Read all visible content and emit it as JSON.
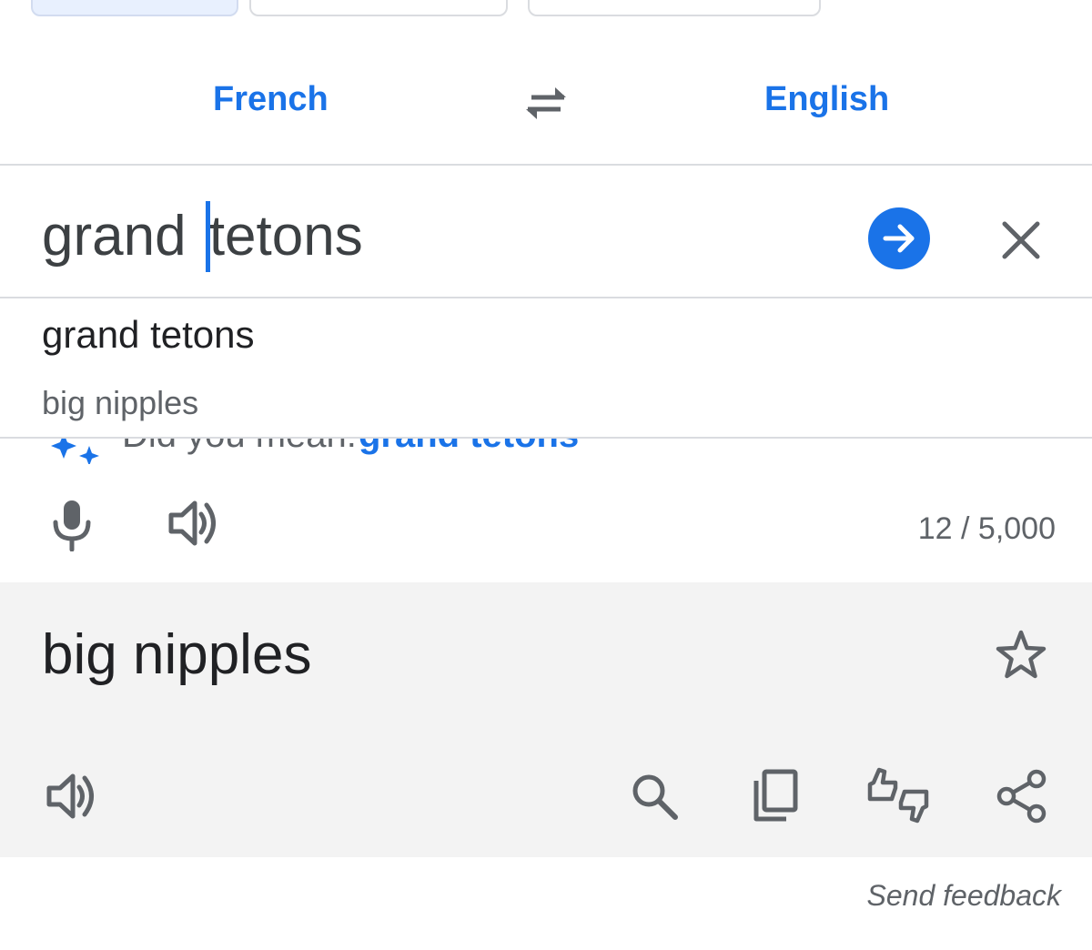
{
  "languages": {
    "source": "French",
    "target": "English"
  },
  "input": {
    "text_before_caret": "grand ",
    "text_after_caret": "tetons"
  },
  "suggestions": {
    "primary": "grand tetons",
    "secondary": "big nipples"
  },
  "did_you_mean": {
    "label": "Did you mean:",
    "suggestion": "grand tetons"
  },
  "counter": "12 / 5,000",
  "translation": {
    "text": "big nipples"
  },
  "footer": {
    "send_feedback": "Send feedback"
  },
  "colors": {
    "accent": "#1a73e8",
    "icon": "#5f6368",
    "result_bg": "#f3f3f3",
    "divider": "#dadce0"
  },
  "icons": {
    "swap": "swap-languages-icon",
    "go": "arrow-right-icon",
    "clear": "close-icon",
    "sparkle": "sparkle-icon",
    "mic": "microphone-icon",
    "speaker": "speaker-icon",
    "star": "star-icon",
    "search": "search-icon",
    "copy": "copy-icon",
    "feedback": "thumbs-feedback-icon",
    "share": "share-icon"
  }
}
